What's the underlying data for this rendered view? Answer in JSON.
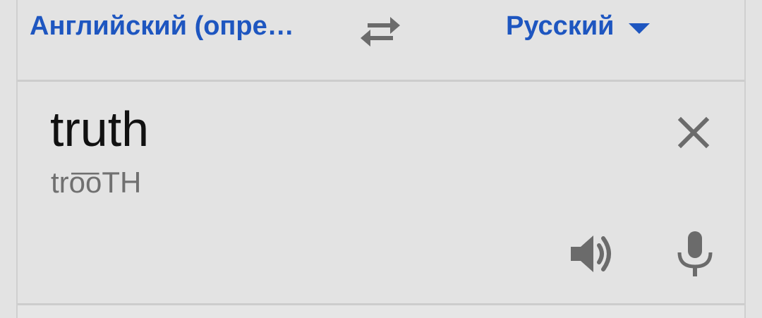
{
  "lang_bar": {
    "source_language": "Английский (опре…",
    "target_language": "Русский",
    "swap_icon": "swap-arrows-icon",
    "dropdown_icon": "triangle-down-icon"
  },
  "input": {
    "text": "truth",
    "transliteration": "tro͞oTH",
    "clear_icon": "close-icon",
    "speaker_icon": "speaker-icon",
    "mic_icon": "microphone-icon"
  },
  "colors": {
    "link_blue": "#1e56c0",
    "icon_gray": "#6b6b6b",
    "background": "#e3e3e3"
  }
}
